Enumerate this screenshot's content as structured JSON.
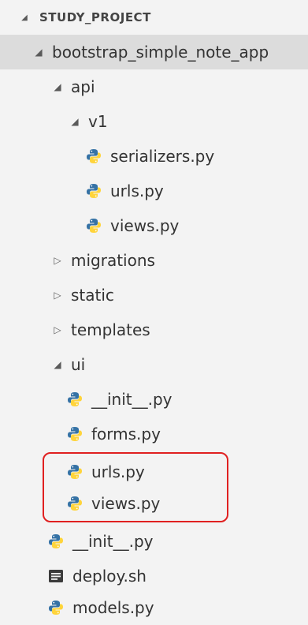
{
  "explorer": {
    "project": {
      "label": "STUDY_PROJECT",
      "expanded": true
    },
    "items": [
      {
        "label": "bootstrap_simple_note_app",
        "type": "folder",
        "expanded": true
      },
      {
        "label": "api",
        "type": "folder",
        "expanded": true
      },
      {
        "label": "v1",
        "type": "folder",
        "expanded": true
      },
      {
        "label": "serializers.py",
        "type": "python-file"
      },
      {
        "label": "urls.py",
        "type": "python-file"
      },
      {
        "label": "views.py",
        "type": "python-file"
      },
      {
        "label": "migrations",
        "type": "folder",
        "expanded": false
      },
      {
        "label": "static",
        "type": "folder",
        "expanded": false
      },
      {
        "label": "templates",
        "type": "folder",
        "expanded": false
      },
      {
        "label": "ui",
        "type": "folder",
        "expanded": true
      },
      {
        "label": "__init__.py",
        "type": "python-file"
      },
      {
        "label": "forms.py",
        "type": "python-file"
      },
      {
        "label": "urls.py",
        "type": "python-file"
      },
      {
        "label": "views.py",
        "type": "python-file"
      },
      {
        "label": "__init__.py",
        "type": "python-file"
      },
      {
        "label": "deploy.sh",
        "type": "shell-file"
      },
      {
        "label": "models.py",
        "type": "python-file"
      }
    ]
  },
  "colors": {
    "highlight_border": "#e02020",
    "python_blue": "#3572A5",
    "python_yellow": "#FFD43B",
    "selected_row": "#dcdcdc"
  },
  "icons": {
    "expanded": "chevron-down-icon",
    "collapsed": "chevron-right-icon",
    "python": "python-file-icon",
    "shell": "shell-file-icon"
  }
}
